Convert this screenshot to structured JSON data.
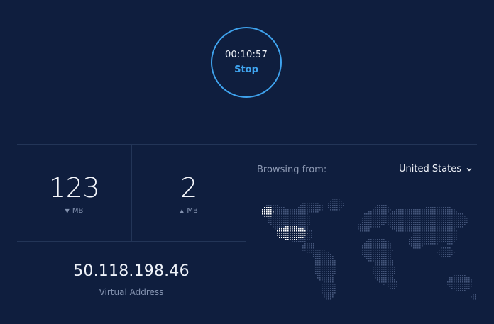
{
  "timer": {
    "elapsed": "00:10:57",
    "action_label": "Stop"
  },
  "stats": {
    "download": {
      "value": "123",
      "unit": "MB",
      "icon": "arrow-down-icon"
    },
    "upload": {
      "value": "2",
      "unit": "MB",
      "icon": "arrow-up-icon"
    }
  },
  "connection": {
    "ip_address": "50.118.198.46",
    "ip_label": "Virtual Address"
  },
  "location": {
    "label": "Browsing from:",
    "selected_country": "United States",
    "dropdown_icon": "chevron-down-icon"
  },
  "colors": {
    "background": "#0f1e3e",
    "accent": "#3fa3ee",
    "divider": "#233557",
    "map_dot": "#44557a",
    "map_highlight": "#ffffff"
  }
}
